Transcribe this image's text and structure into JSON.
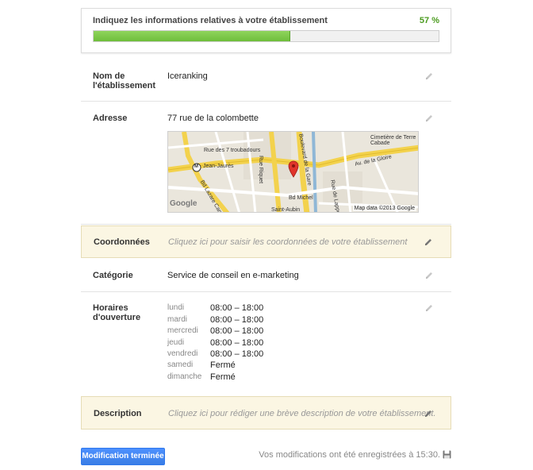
{
  "progress": {
    "title": "Indiquez les informations relatives à votre établissement",
    "percent_label": "57 %",
    "percent": 57
  },
  "fields": {
    "name": {
      "label": "Nom de l'établissement",
      "value": "Iceranking"
    },
    "address": {
      "label": "Adresse",
      "value": "77 rue de la colombette",
      "map": {
        "labels": [
          "Rue des 7 troubadours",
          "Jean-Jaurès",
          "Rue Riquet",
          "Bd Lazare Carn",
          "Boulevard de la Gare",
          "Cimetière de Terre Cabade",
          "Av. de la Gloire",
          "Rue de Lappe",
          "Bd Michel",
          "Saint-Aubin",
          "Google"
        ],
        "credit": "Map data ©2013 Google",
        "metro_marker": "M"
      }
    },
    "coordinates": {
      "label": "Coordonnées",
      "hint": "Cliquez ici pour saisir les coordonnées de votre établissement"
    },
    "category": {
      "label": "Catégorie",
      "value": "Service de conseil en e-marketing"
    },
    "hours": {
      "label": "Horaires d'ouverture",
      "days": [
        {
          "day": "lundi",
          "time": "08:00 – 18:00"
        },
        {
          "day": "mardi",
          "time": "08:00 – 18:00"
        },
        {
          "day": "mercredi",
          "time": "08:00 – 18:00"
        },
        {
          "day": "jeudi",
          "time": "08:00 – 18:00"
        },
        {
          "day": "vendredi",
          "time": "08:00 – 18:00"
        },
        {
          "day": "samedi",
          "time": "Fermé"
        },
        {
          "day": "dimanche",
          "time": "Fermé"
        }
      ]
    },
    "description": {
      "label": "Description",
      "hint": "Cliquez ici pour rédiger une brève description de votre établissement."
    }
  },
  "footer": {
    "done_label": "Modification terminée",
    "save_status": "Vos modifications ont été enregistrées à 15:30."
  },
  "icons": {
    "edit": "pencil-icon",
    "save": "floppy-disk-icon",
    "map_pin": "map-pin-icon"
  },
  "colors": {
    "accent_green": "#6ebe3b",
    "button_blue": "#4d90fe",
    "highlight_bg": "#fbf6e3"
  }
}
